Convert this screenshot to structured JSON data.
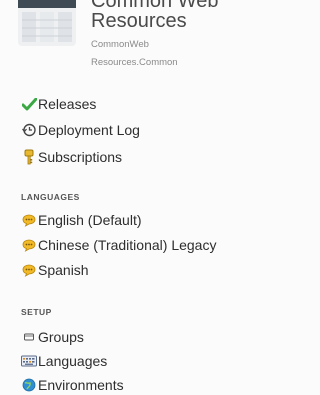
{
  "project": {
    "title_top": "Common Web",
    "title": "Resources",
    "subtitle_line1": "CommonWeb",
    "subtitle_line2": "Resources.Common"
  },
  "nav": {
    "releases": "Releases",
    "deployment_log": "Deployment Log",
    "subscriptions": "Subscriptions"
  },
  "languages": {
    "heading": "LANGUAGES",
    "items": [
      "English (Default)",
      "Chinese (Traditional) Legacy",
      "Spanish"
    ]
  },
  "setup": {
    "heading": "SETUP",
    "items": [
      "Groups",
      "Languages",
      "Environments"
    ]
  },
  "icons": {
    "releases": "check-icon",
    "deployment_log": "history-icon",
    "subscriptions": "key-icon",
    "language": "speech-bubble-icon",
    "groups": "folder-icon",
    "languages": "keyboard-icon",
    "environments": "globe-icon"
  },
  "colors": {
    "check": "#3aa845",
    "language_bubble": "#f2b928",
    "key": "#e8b830",
    "globe": "#2f8fd0"
  }
}
